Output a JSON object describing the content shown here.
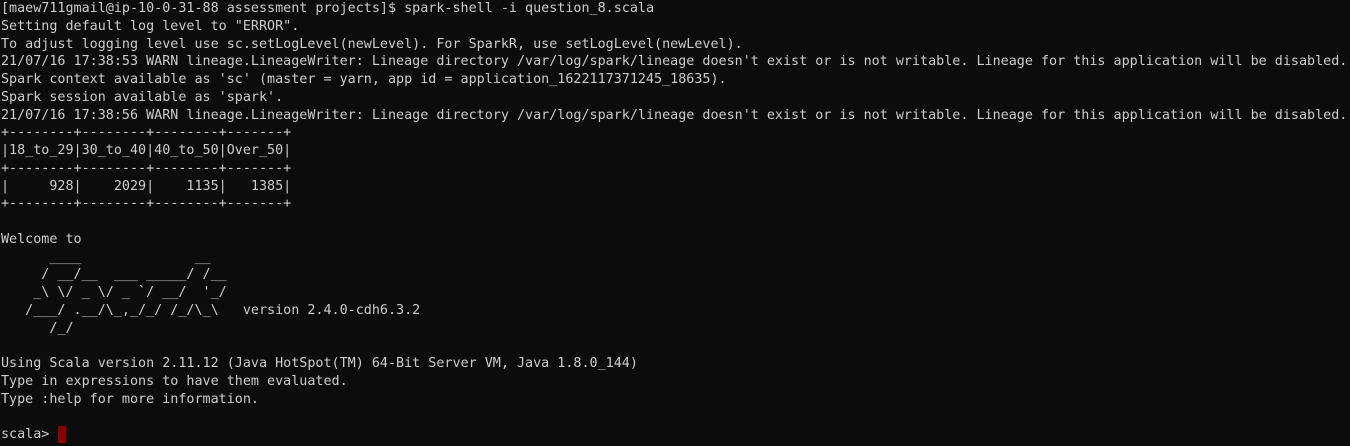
{
  "terminal": {
    "cursor_color": "#8b0000",
    "background_color": "#0c0c0c",
    "text_color": "#cccccc",
    "lines": [
      "[maew711gmail@ip-10-0-31-88 assessment projects]$ spark-shell -i question_8.scala",
      "Setting default log level to \"ERROR\".",
      "To adjust logging level use sc.setLogLevel(newLevel). For SparkR, use setLogLevel(newLevel).",
      "21/07/16 17:38:53 WARN lineage.LineageWriter: Lineage directory /var/log/spark/lineage doesn't exist or is not writable. Lineage for this application will be disabled.",
      "Spark context available as 'sc' (master = yarn, app id = application_1622117371245_18635).",
      "Spark session available as 'spark'.",
      "21/07/16 17:38:56 WARN lineage.LineageWriter: Lineage directory /var/log/spark/lineage doesn't exist or is not writable. Lineage for this application will be disabled.",
      "+--------+--------+--------+-------+",
      "|18_to_29|30_to_40|40_to_50|Over_50|",
      "+--------+--------+--------+-------+",
      "|     928|    2029|    1135|   1385|",
      "+--------+--------+--------+-------+",
      "",
      "Welcome to",
      "      ____              __",
      "     / __/__  ___ _____/ /__",
      "    _\\ \\/ _ \\/ _ `/ __/  '_/",
      "   /___/ .__/\\_,_/_/ /_/\\_\\   version 2.4.0-cdh6.3.2",
      "      /_/",
      "",
      "Using Scala version 2.11.12 (Java HotSpot(TM) 64-Bit Server VM, Java 1.8.0_144)",
      "Type in expressions to have them evaluated.",
      "Type :help for more information.",
      ""
    ],
    "prompt": "scala> "
  }
}
